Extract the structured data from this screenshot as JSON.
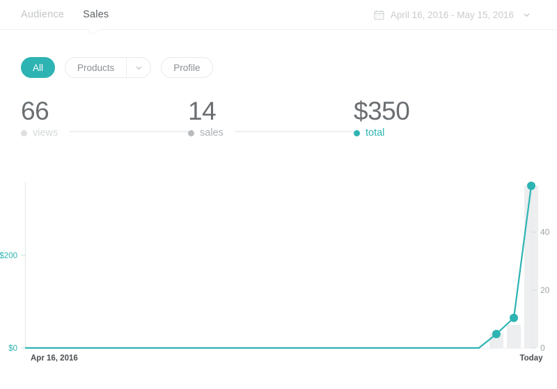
{
  "header": {
    "tabs": [
      {
        "label": "Audience",
        "active": false
      },
      {
        "label": "Sales",
        "active": true
      }
    ],
    "date_range": {
      "label": "April 16, 2016 - May 15, 2016",
      "calendar_icon": "calendar-icon",
      "chevron_icon": "chevron-down-icon"
    }
  },
  "filters": {
    "all": {
      "label": "All",
      "selected": true
    },
    "products": {
      "label": "Products",
      "caret_icon": "chevron-down-icon"
    },
    "profile": {
      "label": "Profile"
    }
  },
  "metrics": [
    {
      "key": "views",
      "value": "66",
      "label": "views",
      "color": "#dddfe0"
    },
    {
      "key": "sales",
      "value": "14",
      "label": "sales",
      "color": "#b9bcbe"
    },
    {
      "key": "total",
      "value": "$350",
      "label": "total",
      "color": "#2eb3b3"
    }
  ],
  "colors": {
    "accent": "#2eb3b3",
    "bar": "#eceeef",
    "muted": "#c3c6c8",
    "text": "#55595c"
  },
  "chart_data": {
    "type": "line",
    "title": "",
    "xlabel": "",
    "ylabel": "",
    "x_tick_labels": [
      "Apr 16, 2016",
      "Today"
    ],
    "left_axis": {
      "label": "total",
      "ticks": [
        "$0",
        "$200"
      ],
      "tick_values": [
        0,
        200
      ],
      "ylim": [
        0,
        350
      ],
      "color": "#2eb3b3"
    },
    "right_axis": {
      "label": "views",
      "ticks": [
        "0",
        "20",
        "40"
      ],
      "tick_values": [
        0,
        20,
        40
      ],
      "ylim": [
        0,
        56
      ],
      "color": "#9ea2a5"
    },
    "grid": false,
    "legend": "none",
    "series": [
      {
        "name": "total",
        "type": "line",
        "axis": "left",
        "color": "#2eb3b3",
        "x": [
          0,
          1,
          2,
          3,
          4,
          5,
          6,
          7,
          8,
          9,
          10,
          11,
          12,
          13,
          14,
          15,
          16,
          17,
          18,
          19,
          20,
          21,
          22,
          23,
          24,
          25,
          26,
          27,
          28,
          29
        ],
        "values": [
          0,
          0,
          0,
          0,
          0,
          0,
          0,
          0,
          0,
          0,
          0,
          0,
          0,
          0,
          0,
          0,
          0,
          0,
          0,
          0,
          0,
          0,
          0,
          0,
          0,
          0,
          0,
          30,
          65,
          350
        ],
        "marked_points": [
          {
            "x": 27,
            "value": 30
          },
          {
            "x": 28,
            "value": 65
          },
          {
            "x": 29,
            "value": 350
          }
        ]
      },
      {
        "name": "views",
        "type": "bar",
        "axis": "right",
        "color": "#eceeef",
        "x": [
          27,
          28,
          29
        ],
        "values": [
          5,
          8,
          56
        ]
      }
    ]
  }
}
